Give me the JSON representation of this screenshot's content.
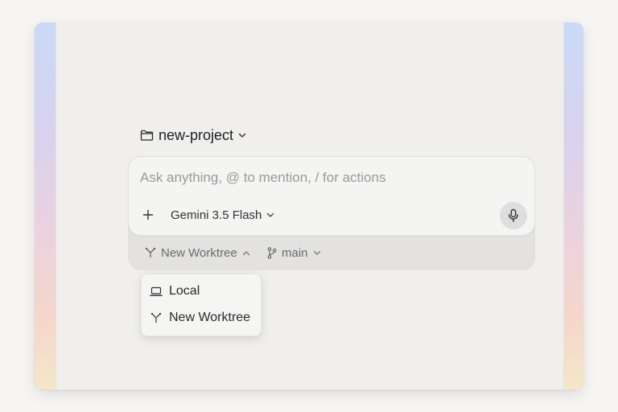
{
  "project": {
    "name": "new-project",
    "icon": "folder-icon"
  },
  "composer": {
    "placeholder": "Ask anything, @ to mention, / for actions",
    "value": "",
    "model_label": "Gemini 3.5 Flash",
    "add_icon": "plus-icon",
    "mic_icon": "microphone-icon"
  },
  "footer": {
    "worktree_label": "New Worktree",
    "branch_label": "main"
  },
  "menu": {
    "items": [
      {
        "label": "Local",
        "icon": "laptop-icon"
      },
      {
        "label": "New Worktree",
        "icon": "worktree-icon"
      }
    ]
  },
  "colors": {
    "canvas": "#f0efee",
    "composer": "#f4f4f3",
    "footer_band": "#e3e2e1",
    "text_primary": "#1f1f1f",
    "text_muted": "#6a6a6a",
    "placeholder": "#9a9a9a"
  }
}
